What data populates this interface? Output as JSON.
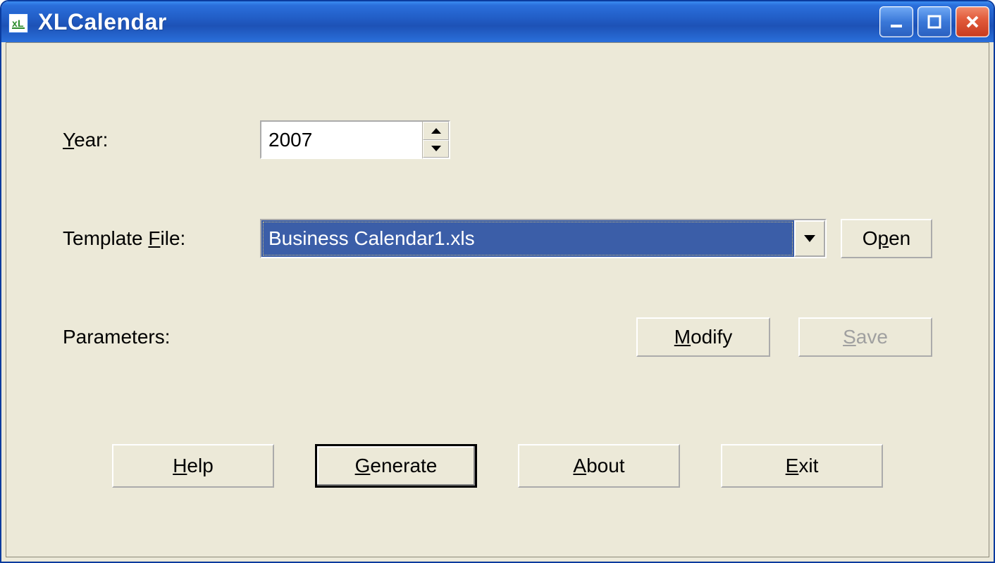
{
  "window": {
    "title": "XLCalendar",
    "icon_label": "xL"
  },
  "form": {
    "year_label_prefix": "Y",
    "year_label_rest": "ear:",
    "year_value": "2007",
    "template_label_prefix": "Template ",
    "template_label_u": "F",
    "template_label_rest": "ile:",
    "template_selected": "Business Calendar1.xls",
    "open_prefix": "O",
    "open_u": "p",
    "open_rest": "en",
    "parameters_label": "Parameters:",
    "modify_u": "M",
    "modify_rest": "odify",
    "save_u": "S",
    "save_rest": "ave"
  },
  "bottom": {
    "help_u": "H",
    "help_rest": "elp",
    "generate_u": "G",
    "generate_rest": "enerate",
    "about_u": "A",
    "about_rest": "bout",
    "exit_u": "E",
    "exit_rest": "xit"
  }
}
